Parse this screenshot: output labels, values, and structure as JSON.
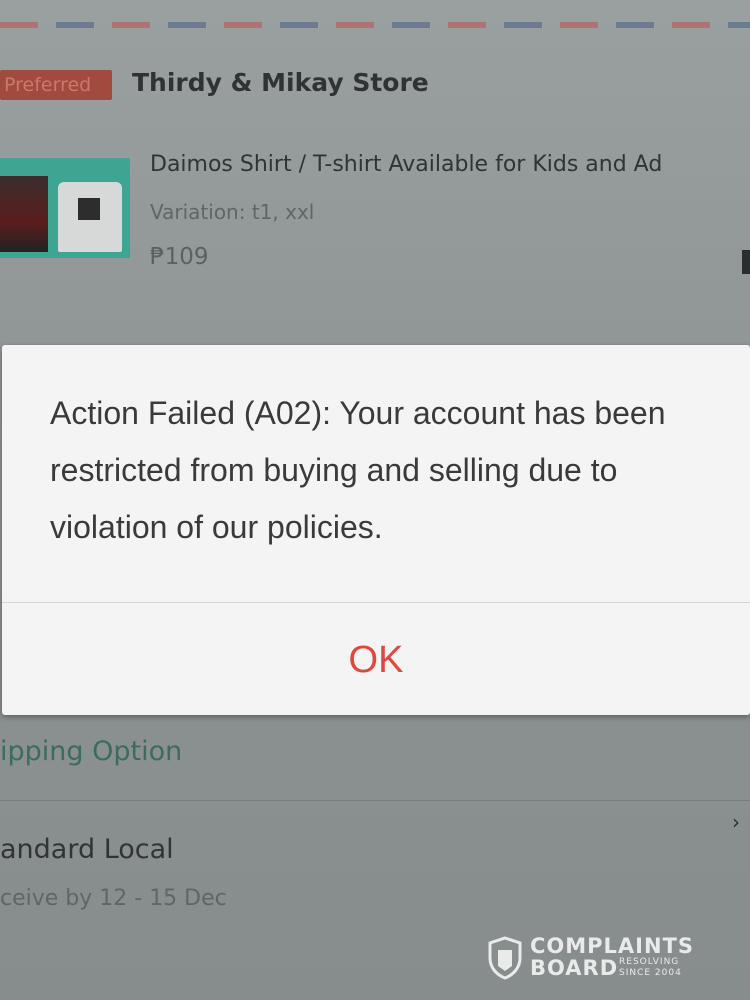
{
  "store": {
    "badge": "Preferred",
    "name": "Thirdy &  Mikay Store"
  },
  "product": {
    "title": "Daimos Shirt / T-shirt  Available for Kids and Ad",
    "variation": "Variation: t1, xxl",
    "price": "₱109"
  },
  "dialog": {
    "message": "Action Failed (A02): Your account has been restricted from buying and selling due to violation of our policies.",
    "ok_label": "OK",
    "accent": "#e0483b"
  },
  "shipping": {
    "label": "ipping Option",
    "method": "andard Local",
    "receive": "ceive by 12 - 15 Dec"
  },
  "watermark": {
    "line1": "COMPLAINTS",
    "line2": "BOARD",
    "sub1": "RESOLVING",
    "sub2": "SINCE 2004"
  }
}
